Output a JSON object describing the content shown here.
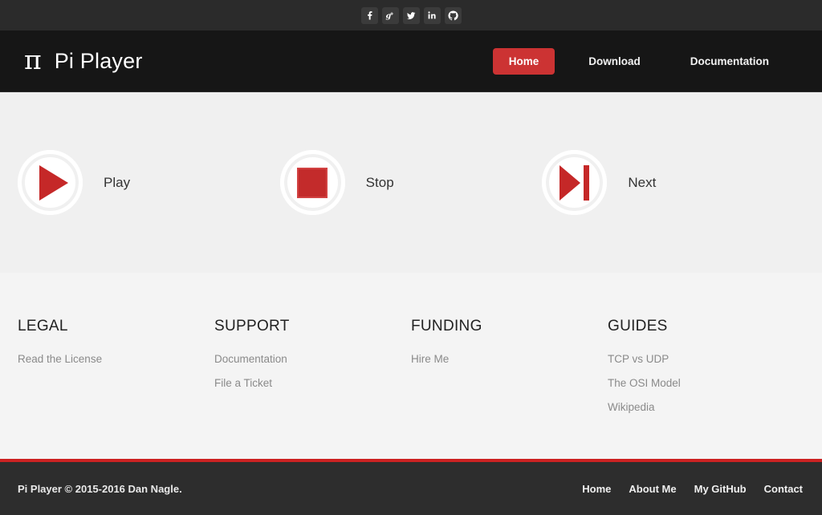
{
  "topbar": {
    "social": [
      {
        "name": "facebook-icon",
        "label": "f"
      },
      {
        "name": "google-plus-icon",
        "label": "g+"
      },
      {
        "name": "twitter-icon",
        "label": "twitter"
      },
      {
        "name": "linkedin-icon",
        "label": "in"
      },
      {
        "name": "github-icon",
        "label": "github"
      }
    ]
  },
  "header": {
    "logo_glyph": "π",
    "brand": "Pi Player",
    "nav": [
      {
        "label": "Home",
        "active": true
      },
      {
        "label": "Download",
        "active": false
      },
      {
        "label": "Documentation",
        "active": false
      }
    ]
  },
  "hero": {
    "controls": [
      {
        "label": "Play",
        "icon": "play-icon"
      },
      {
        "label": "Stop",
        "icon": "stop-icon"
      },
      {
        "label": "Next",
        "icon": "next-icon"
      }
    ]
  },
  "link_columns": [
    {
      "title": "LEGAL",
      "links": [
        "Read the License"
      ]
    },
    {
      "title": "SUPPORT",
      "links": [
        "Documentation",
        "File a Ticket"
      ]
    },
    {
      "title": "FUNDING",
      "links": [
        "Hire Me"
      ]
    },
    {
      "title": "GUIDES",
      "links": [
        "TCP vs UDP",
        "The OSI Model",
        "Wikipedia"
      ]
    }
  ],
  "footer": {
    "copyright": "Pi Player © 2015-2016 Dan Nagle.",
    "links": [
      "Home",
      "About Me",
      "My GitHub",
      "Contact"
    ]
  },
  "colors": {
    "accent_red": "#cc3333",
    "icon_red": "#c52828",
    "header_dark": "#161616",
    "topbar_dark": "#2b2b2b",
    "footer_dark": "#2d2d2d",
    "hero_bg": "#f0f0f0",
    "links_bg": "#f4f4f4"
  }
}
